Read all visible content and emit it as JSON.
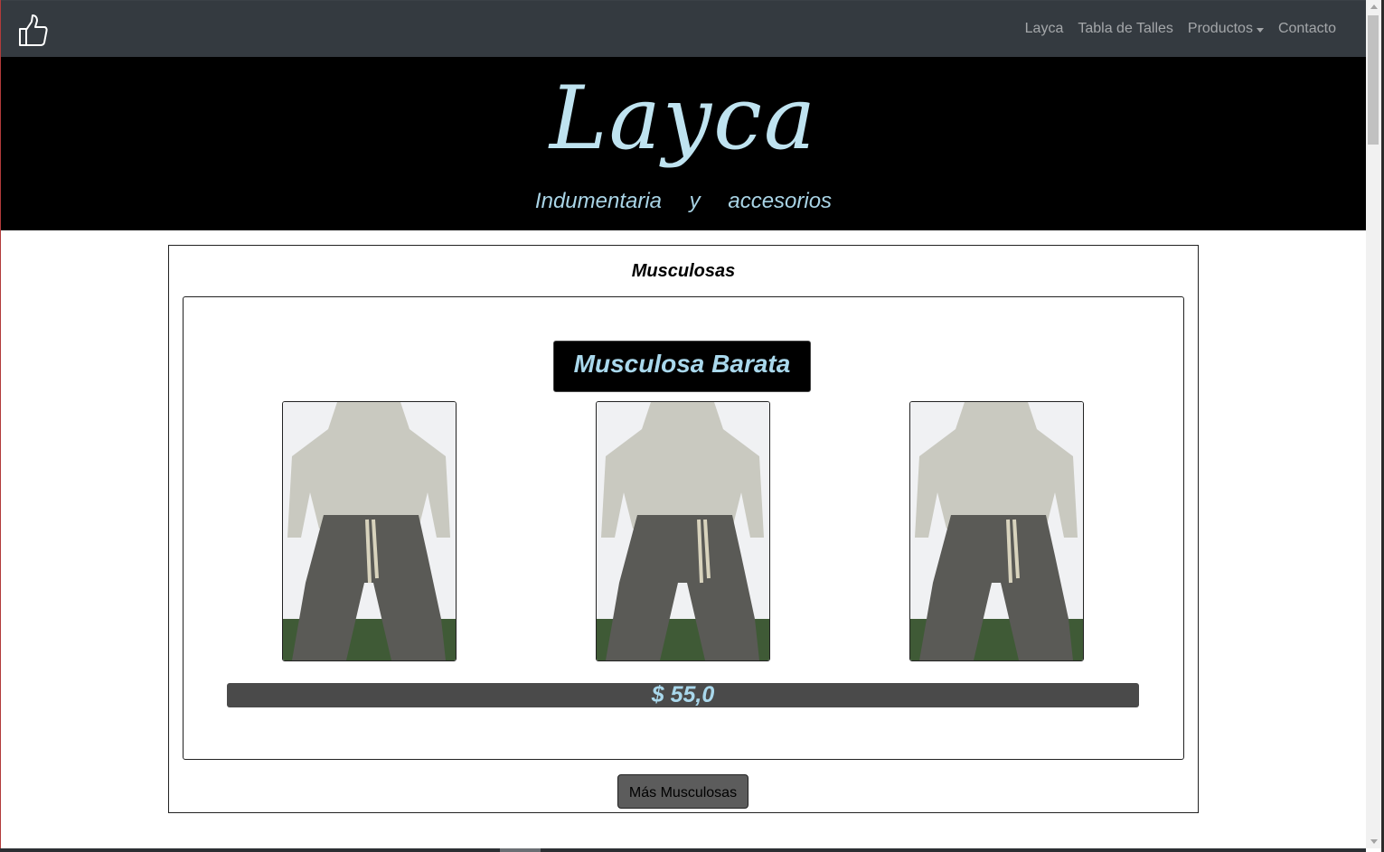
{
  "navbar": {
    "brand_icon": "thumbs-up-icon",
    "links": [
      {
        "label": "Layca"
      },
      {
        "label": "Tabla de Talles"
      },
      {
        "label": "Productos",
        "dropdown": true
      },
      {
        "label": "Contacto"
      }
    ]
  },
  "hero": {
    "logo_text": "Layca",
    "subtitle": "Indumentaria y accesorios"
  },
  "section": {
    "title": "Musculosas",
    "product": {
      "title": "Musculosa Barata",
      "price": "$ 55,0",
      "photo_count": 3
    },
    "more_button": "Más Musculosas"
  },
  "colors": {
    "navbar_bg": "#343a40",
    "hero_bg": "#000000",
    "accent_text": "#a9d8ec",
    "price_bar_bg": "#4a4a4a",
    "button_bg": "#5c5c5c"
  }
}
